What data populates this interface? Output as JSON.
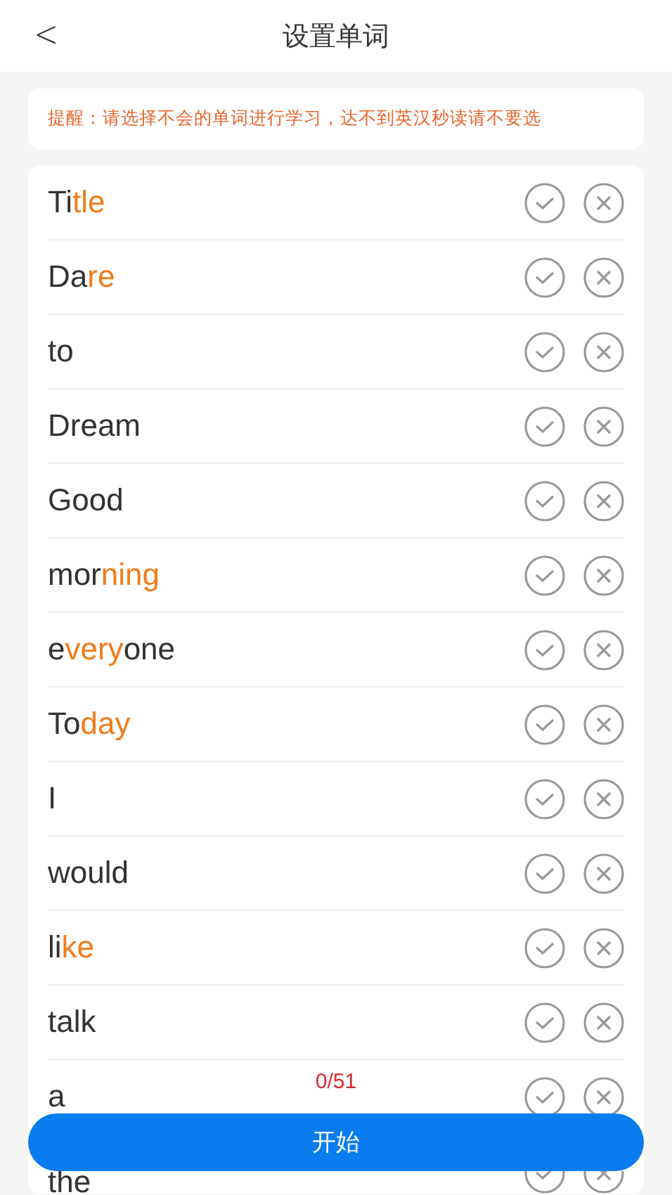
{
  "header": {
    "back": "<",
    "title": "设置单词"
  },
  "notice": "提醒：请选择不会的单词进行学习，达不到英汉秒读请不要选",
  "words": [
    {
      "parts": [
        {
          "text": "Ti",
          "highlight": false
        },
        {
          "text": "tle",
          "highlight": true
        }
      ]
    },
    {
      "parts": [
        {
          "text": "Da",
          "highlight": false
        },
        {
          "text": "re",
          "highlight": true
        }
      ]
    },
    {
      "parts": [
        {
          "text": "to",
          "highlight": false
        }
      ]
    },
    {
      "parts": [
        {
          "text": "Dream",
          "highlight": false
        }
      ]
    },
    {
      "parts": [
        {
          "text": "Good",
          "highlight": false
        }
      ]
    },
    {
      "parts": [
        {
          "text": "mor",
          "highlight": false
        },
        {
          "text": "ning",
          "highlight": true
        }
      ]
    },
    {
      "parts": [
        {
          "text": "e",
          "highlight": false
        },
        {
          "text": "very",
          "highlight": true
        },
        {
          "text": "one",
          "highlight": false
        }
      ]
    },
    {
      "parts": [
        {
          "text": "To",
          "highlight": false
        },
        {
          "text": "day",
          "highlight": true
        }
      ]
    },
    {
      "parts": [
        {
          "text": "I",
          "highlight": false
        }
      ]
    },
    {
      "parts": [
        {
          "text": "would",
          "highlight": false
        }
      ]
    },
    {
      "parts": [
        {
          "text": "li",
          "highlight": false
        },
        {
          "text": "ke",
          "highlight": true
        }
      ]
    },
    {
      "parts": [
        {
          "text": "talk",
          "highlight": false
        }
      ]
    },
    {
      "parts": [
        {
          "text": "a",
          "highlight": false
        }
      ]
    },
    {
      "parts": [
        {
          "text": "the",
          "highlight": false
        }
      ]
    }
  ],
  "counter": "0/51",
  "start_button": "开始"
}
